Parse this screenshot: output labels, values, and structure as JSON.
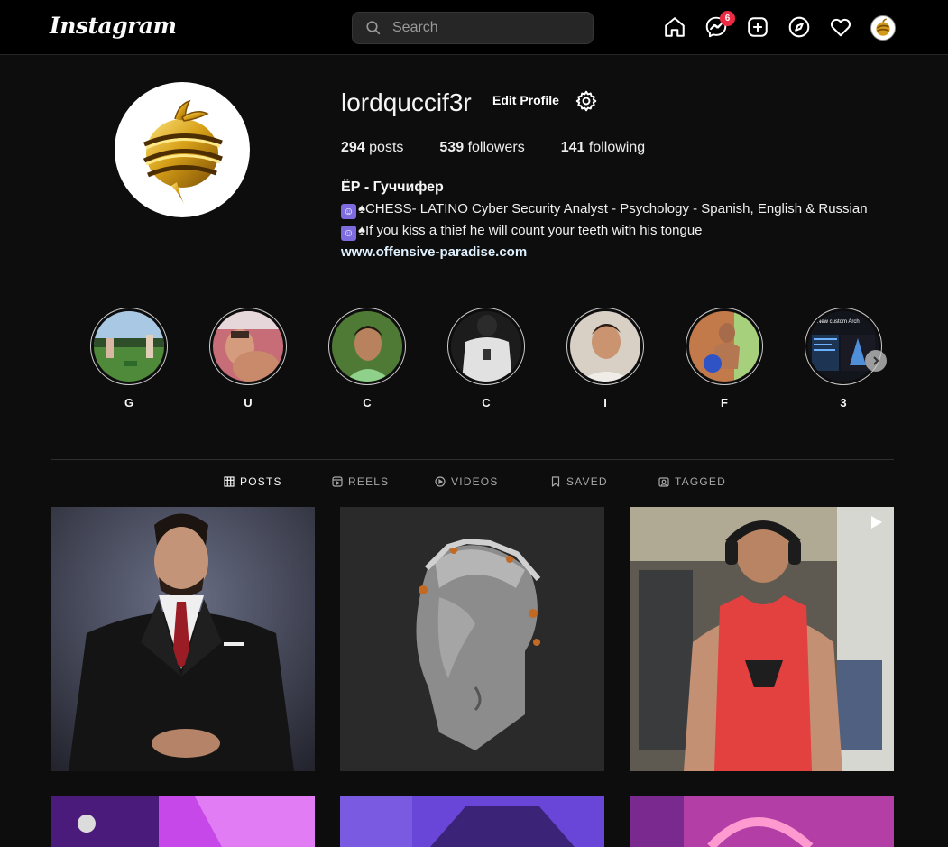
{
  "nav": {
    "logo": "Instagram",
    "search_placeholder": "Search",
    "messages_badge": "6"
  },
  "profile": {
    "username": "lordquccif3r",
    "edit_label": "Edit Profile",
    "posts_count": "294",
    "posts_label": "posts",
    "followers_count": "539",
    "followers_label": "followers",
    "following_count": "141",
    "following_label": "following",
    "full_name": "ЁР - Гуччифер",
    "bio_line1": "♠CHESS- LATINO Cyber Security Analyst - Psychology - Spanish, English & Russian",
    "bio_line2": "♠If you kiss a thief he will count your teeth with his tongue",
    "link": "www.offensive-paradise.com"
  },
  "highlights": [
    {
      "label": "G"
    },
    {
      "label": "U"
    },
    {
      "label": "C"
    },
    {
      "label": "C"
    },
    {
      "label": "I"
    },
    {
      "label": "F"
    },
    {
      "label": "3",
      "caption": "New custom Arch"
    }
  ],
  "tabs": [
    {
      "label": "POSTS",
      "icon": "grid-icon"
    },
    {
      "label": "REELS",
      "icon": "reels-icon"
    },
    {
      "label": "VIDEOS",
      "icon": "play-icon"
    },
    {
      "label": "SAVED",
      "icon": "bookmark-icon"
    },
    {
      "label": "TAGGED",
      "icon": "tag-icon"
    }
  ],
  "colors": {
    "background": "#0d0d0d",
    "badge": "#ed2a43",
    "link": "#e0f1ff"
  }
}
